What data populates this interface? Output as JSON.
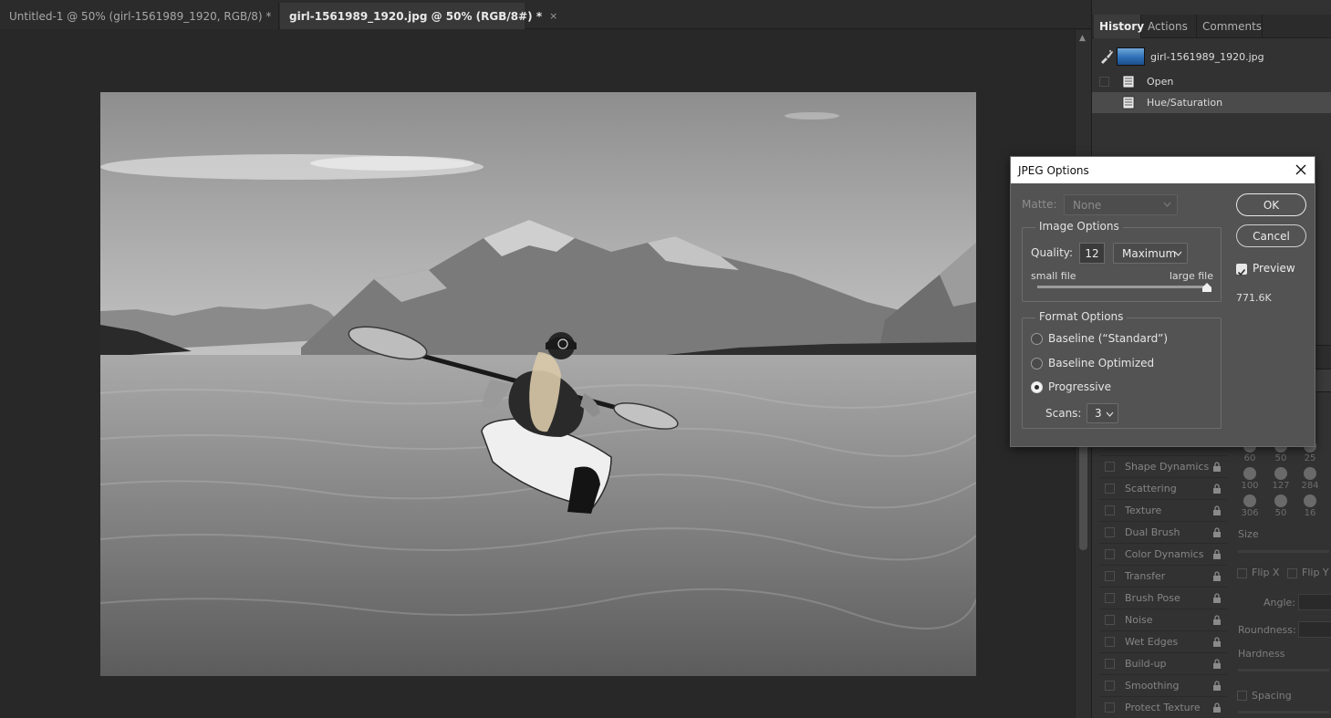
{
  "tabs": [
    {
      "title": "Untitled-1 @ 50% (girl-1561989_1920, RGB/8) *",
      "close": "×",
      "active": false
    },
    {
      "title": "girl-1561989_1920.jpg @ 50% (RGB/8#) *",
      "close": "×",
      "active": true
    }
  ],
  "history_panel": {
    "tabs": [
      "History",
      "Actions",
      "Comments"
    ],
    "snapshot_name": "girl-1561989_1920.jpg",
    "states": [
      {
        "label": "Open",
        "selected": false
      },
      {
        "label": "Hue/Saturation",
        "selected": true
      }
    ]
  },
  "brush_settings": {
    "items": [
      "Shape Dynamics",
      "Scattering",
      "Texture",
      "Dual Brush",
      "Color Dynamics",
      "Transfer",
      "Brush Pose",
      "Noise",
      "Wet Edges",
      "Build-up",
      "Smoothing",
      "Protect Texture"
    ],
    "brush_sizes": [
      "60",
      "50",
      "25",
      "100",
      "127",
      "284",
      "306",
      "50",
      "16"
    ],
    "labels": {
      "size": "Size",
      "flip_x": "Flip X",
      "flip_y": "Flip Y",
      "angle": "Angle:",
      "roundness": "Roundness:",
      "hardness": "Hardness",
      "spacing": "Spacing"
    }
  },
  "jpeg_dialog": {
    "title": "JPEG Options",
    "close": "✕",
    "matte_label": "Matte:",
    "matte_value": "None",
    "image_options": {
      "legend": "Image Options",
      "quality_label": "Quality:",
      "quality_value": "12",
      "quality_preset": "Maximum",
      "small_label": "small file",
      "large_label": "large file",
      "quality_fraction": 1.0
    },
    "format_options": {
      "legend": "Format Options",
      "options": [
        {
          "label": "Baseline (“Standard”)",
          "selected": false
        },
        {
          "label": "Baseline Optimized",
          "selected": false
        },
        {
          "label": "Progressive",
          "selected": true
        }
      ],
      "scans_label": "Scans:",
      "scans_value": "3"
    },
    "ok_label": "OK",
    "cancel_label": "Cancel",
    "preview_label": "Preview",
    "preview_checked": true,
    "file_size": "771.6K"
  }
}
